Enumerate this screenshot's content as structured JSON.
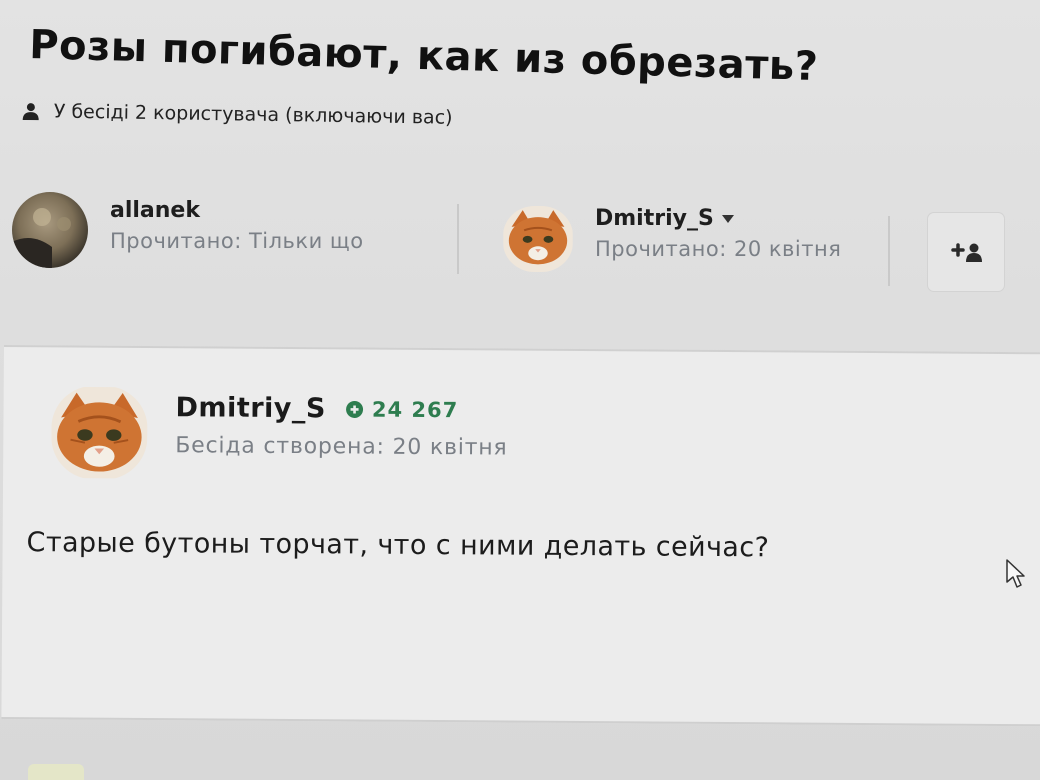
{
  "conversation": {
    "title": "Розы погибают, как из обрезать?",
    "participants_summary": "У бесіді 2 користувача (включаючи вас)"
  },
  "participants": [
    {
      "name": "allanek",
      "read_status": "Прочитано: Тільки що"
    },
    {
      "name": "Dmitriy_S",
      "read_status": "Прочитано: 20 квітня"
    }
  ],
  "message": {
    "author": "Dmitriy_S",
    "reputation": "24 267",
    "created": "Бесіда створена: 20 квітня",
    "body": "Старые бутоны торчат, что с ними делать сейчас?"
  },
  "icons": {
    "user": "user-icon",
    "add_user": "add-user-icon",
    "caret": "caret-down-icon",
    "reputation": "plus-circle-icon",
    "cursor": "mouse-cursor-icon"
  },
  "colors": {
    "reputation": "#2e7d4f",
    "muted_text": "#7a7f86",
    "avatar_cat": "#c8692a"
  }
}
